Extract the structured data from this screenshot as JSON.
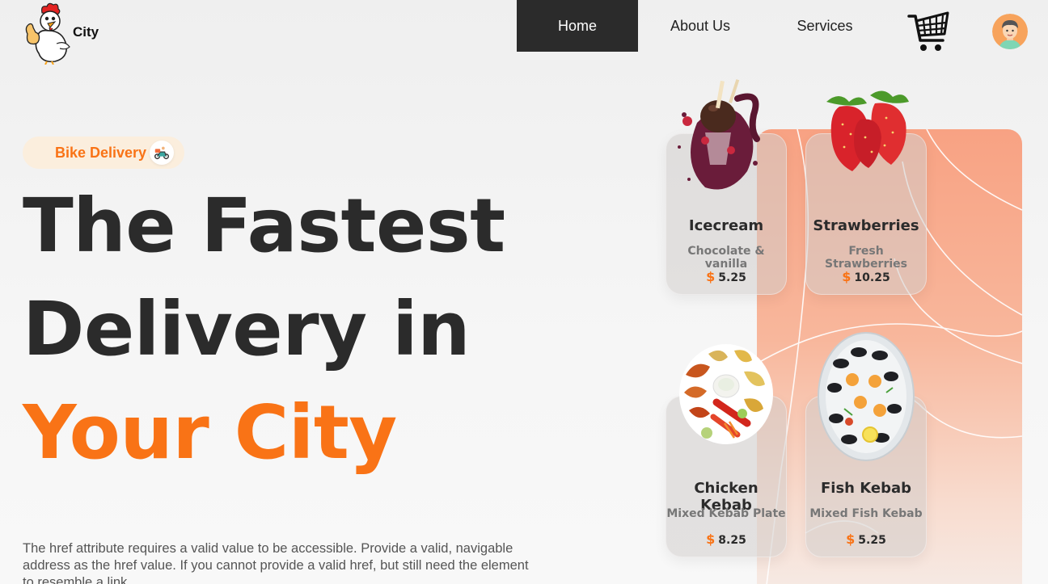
{
  "brand": {
    "name": "City"
  },
  "nav": {
    "items": [
      {
        "label": "Home",
        "active": true
      },
      {
        "label": "About Us",
        "active": false
      },
      {
        "label": "Services",
        "active": false
      }
    ]
  },
  "colors": {
    "accent": "#f97316",
    "dark": "#2b2b2b",
    "panel": "#f8a283"
  },
  "hero": {
    "badge": "Bike Delivery",
    "headline_1": "The Fastest",
    "headline_2": "Delivery in",
    "headline_3": "Your City",
    "description": "The href attribute requires a valid value to be accessible. Provide a valid, navigable address as the href value. If you cannot provide a valid href, but still need the element to resemble a link"
  },
  "menu": {
    "items": [
      {
        "name": "Icecream",
        "desc": "Chocolate & vanilla",
        "currency": "$",
        "price": "5.25",
        "icon": "icecream-image"
      },
      {
        "name": "Strawberries",
        "desc": "Fresh Strawberries",
        "currency": "$",
        "price": "10.25",
        "icon": "strawberries-image"
      },
      {
        "name": "Chicken Kebab",
        "desc": "Mixed Kebab Plate",
        "currency": "$",
        "price": "8.25",
        "icon": "chicken-kebab-image"
      },
      {
        "name": "Fish Kebab",
        "desc": "Mixed Fish Kebab",
        "currency": "$",
        "price": "5.25",
        "icon": "fish-kebab-image"
      }
    ]
  },
  "icons": {
    "cart": "cart-icon",
    "avatar": "avatar",
    "bike": "scooter-icon",
    "logo": "chicken-logo"
  }
}
